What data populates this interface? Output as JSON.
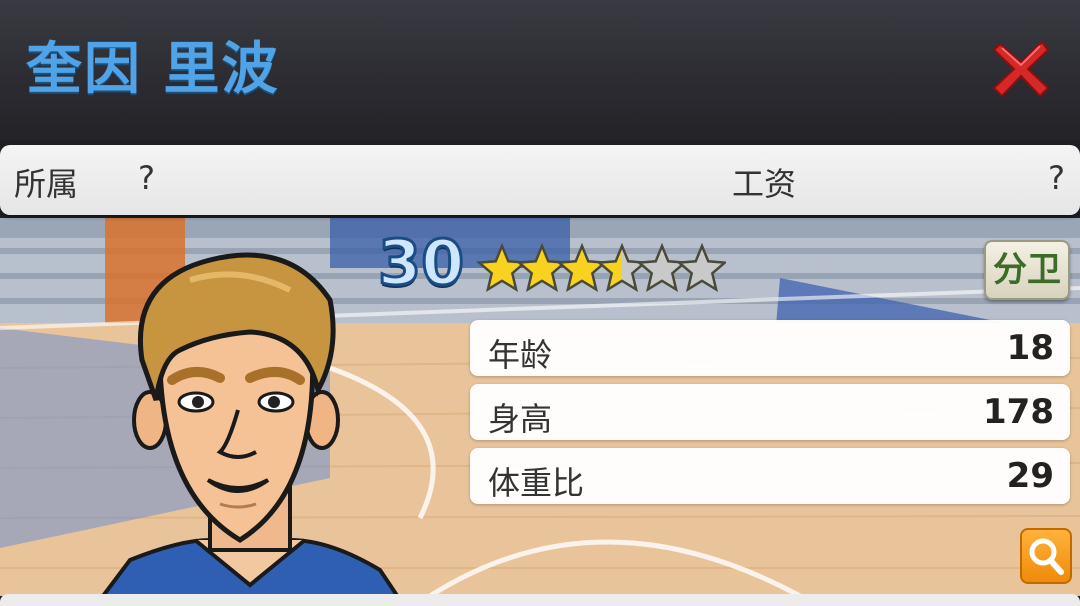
{
  "header": {
    "player_name": "奎因 里波"
  },
  "info_bar": {
    "team_label": "所属",
    "team_value": "?",
    "salary_label": "工资",
    "salary_value": "?"
  },
  "player": {
    "level": "30",
    "stars_filled": 3.5,
    "stars_total": 6,
    "position": "分卫"
  },
  "stats": [
    {
      "label": "年龄",
      "value": "18"
    },
    {
      "label": "身高",
      "value": "178"
    },
    {
      "label": "体重比",
      "value": "29"
    }
  ],
  "colors": {
    "name_blue": "#4fa3e6",
    "close_red": "#d62828",
    "star_gold": "#f7d21e",
    "star_gray": "#c9c9c9",
    "search_orange": "#f59a14"
  },
  "icons": {
    "close": "close-icon",
    "search": "search-icon",
    "star": "star-icon"
  }
}
